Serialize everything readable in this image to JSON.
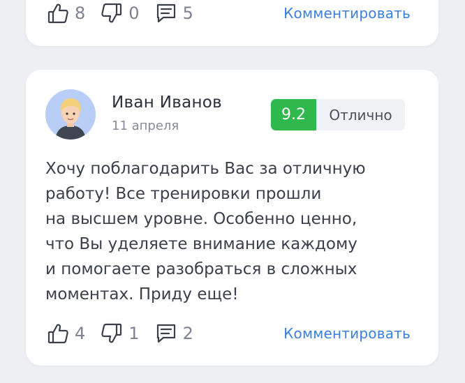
{
  "top_card": {
    "likes": "8",
    "dislikes": "0",
    "comments": "5",
    "comment_label": "Комментировать"
  },
  "review_card": {
    "author": "Иван Иванов",
    "date": "11 апреля",
    "rating_score": "9.2",
    "rating_label": "Отлично",
    "text_lines": [
      "Хочу поблагодарить Вас за отличную",
      "работу! Все тренировки прошли",
      "на высшем уровне. Особенно ценно,",
      "что Вы уделяете внимание каждому",
      "и помогаете разобраться в сложных",
      "моментах. Приду еще!"
    ],
    "likes": "4",
    "dislikes": "1",
    "comments": "2",
    "comment_label": "Комментировать"
  },
  "icons": {
    "like": "thumbs-up-icon",
    "dislike": "thumbs-down-icon",
    "comment": "comment-icon"
  },
  "colors": {
    "accent_link": "#3a7fe0",
    "rating_green": "#2fb84c",
    "background": "#eef0f4"
  }
}
